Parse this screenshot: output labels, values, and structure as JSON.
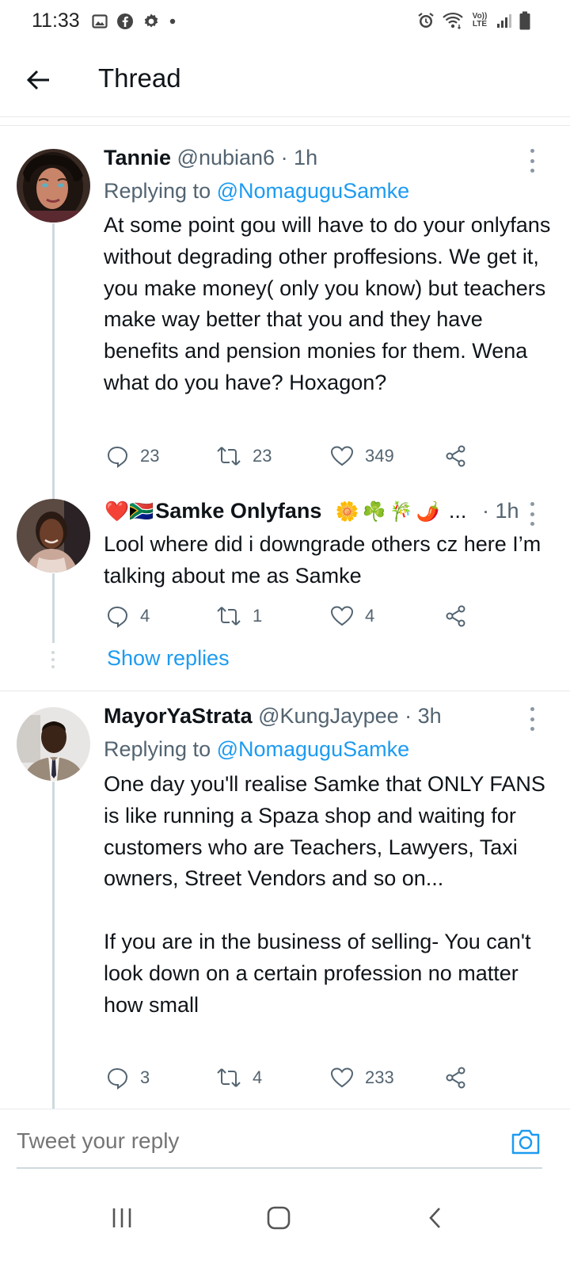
{
  "status_bar": {
    "time": "11:33",
    "left_icons": [
      "gallery-icon",
      "facebook-icon",
      "settings-icon",
      "dot-icon"
    ],
    "right_icons": [
      "alarm-icon",
      "wifi-icon",
      "volte-icon",
      "signal-icon",
      "battery-icon"
    ],
    "volte_text": "Vo)) LTE"
  },
  "header": {
    "title": "Thread"
  },
  "tweets": [
    {
      "name": "Tannie",
      "handle": "@nubian6",
      "time": "· 1h",
      "replying_prefix": "Replying to ",
      "replying_to": "@NomaguguSamke",
      "body": "At some point gou will have to do your onlyfans without degrading other proffesions. We get it, you make money( only you know) but teachers make way better that you and they have benefits and pension monies for them. Wena what do you have? Hoxagon?",
      "replies": "23",
      "retweets": "23",
      "likes": "349"
    },
    {
      "name": "Samke Onlyfans",
      "name_prefix_emoji": "❤️🇿🇦",
      "name_suffix_emoji": "🌼☘️🎋🌶️",
      "ellipsis": "...",
      "time": "· 1h",
      "body": "Lool where did i downgrade others cz here I’m talking about me as Samke",
      "replies": "4",
      "retweets": "1",
      "likes": "4"
    },
    {
      "name": "MayorYaStrata",
      "handle": "@KungJaypee",
      "time": "· 3h",
      "replying_prefix": "Replying to ",
      "replying_to": "@NomaguguSamke",
      "body": "One day you'll realise Samke that ONLY FANS is like running a Spaza shop and waiting for customers who are Teachers, Lawyers, Taxi owners, Street Vendors and so on...\n\nIf you are in the business of selling- You can't  look down on a certain profession no matter how small",
      "replies": "3",
      "retweets": "4",
      "likes": "233"
    }
  ],
  "show_replies": "Show replies",
  "composer": {
    "placeholder": "Tweet your reply"
  },
  "colors": {
    "link": "#1d9bf0",
    "text": "#0f1419",
    "secondary": "#536471",
    "divider": "#e6e9eb"
  }
}
